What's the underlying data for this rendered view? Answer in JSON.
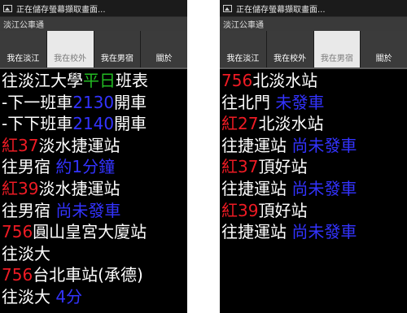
{
  "status_text": "正在儲存螢幕擷取畫面...",
  "app_title": "淡江公車通",
  "colors": {
    "route": "#ee1b24",
    "time": "#3333ff",
    "weekday": "#22bb22",
    "active_tab": "#e9e9e9"
  },
  "tabs": [
    "我在淡江",
    "我在校外",
    "我在男宿",
    "關於"
  ],
  "left": {
    "active_tab": "我在校外",
    "header": {
      "p1": "往淡江大學",
      "p2": "平日",
      "p3": "班表"
    },
    "next1": {
      "a": "-下一班車",
      "b": "2130",
      "c": "開車"
    },
    "next2": {
      "a": "-下下班車",
      "b": "2140",
      "c": "開車"
    },
    "stops": [
      {
        "route": "紅37",
        "stop": "淡水捷運站",
        "dest": "往男宿",
        "eta": "約1分鐘"
      },
      {
        "route": "紅39",
        "stop": "淡水捷運站",
        "dest": "往男宿",
        "eta": "尚未發車"
      },
      {
        "route": "756",
        "stop": "圓山皇宮大廈站",
        "dest": "往淡大",
        "eta": ""
      },
      {
        "route": "756",
        "stop": "台北車站(承德)",
        "dest": "往淡大",
        "eta": "4分"
      }
    ]
  },
  "right": {
    "active_tab": "我在男宿",
    "stops": [
      {
        "route": "756",
        "stop": "北淡水站",
        "dest": "往北門",
        "eta": "未發車"
      },
      {
        "route": "紅27",
        "stop": "北淡水站",
        "dest": "往捷運站",
        "eta": "尚未發車"
      },
      {
        "route": "紅37",
        "stop": "頂好站",
        "dest": "往捷運站",
        "eta": "尚未發車"
      },
      {
        "route": "紅39",
        "stop": "頂好站",
        "dest": "往捷運站",
        "eta": "尚未發車"
      }
    ]
  }
}
